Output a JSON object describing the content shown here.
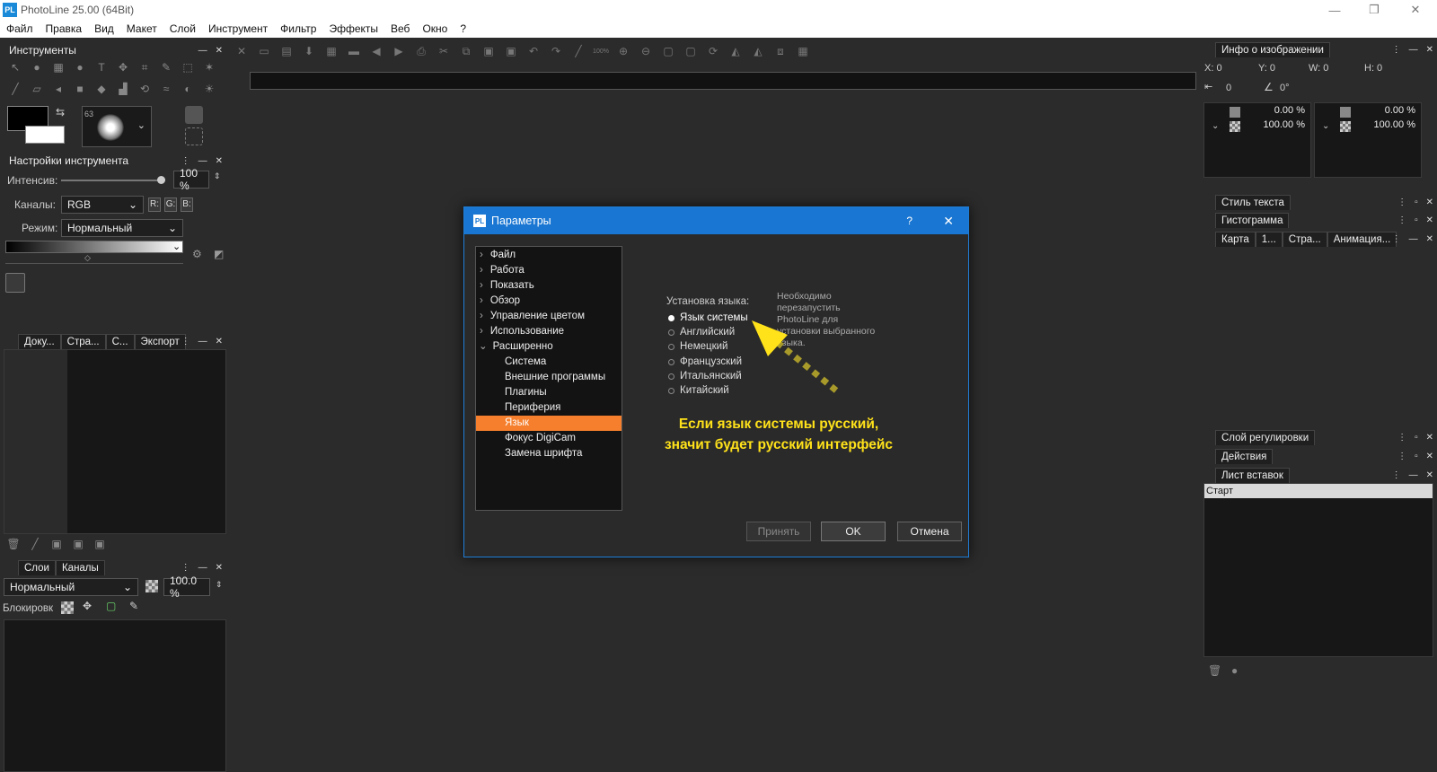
{
  "app": {
    "title": "PhotoLine 25.00 (64Bit)",
    "logo": "PL"
  },
  "window_controls": {
    "minimize": "—",
    "maximize": "❐",
    "close": "✕"
  },
  "menu": [
    "Файл",
    "Правка",
    "Вид",
    "Макет",
    "Слой",
    "Инструмент",
    "Фильтр",
    "Эффекты",
    "Веб",
    "Окно",
    "?"
  ],
  "left": {
    "tools_title": "Инструменты",
    "brush_size": "63",
    "tool_settings_title": "Настройки инструмента",
    "intensity_label": "Интенсив:",
    "intensity_value": "100 %",
    "channels_label": "Каналы:",
    "channels_value": "RGB",
    "channel_buttons": [
      "R:",
      "G:",
      "B:"
    ],
    "mode_label": "Режим:",
    "mode_value": "Нормальный",
    "doc_tabs": [
      "Доку...",
      "Стра...",
      "С...",
      "Экспорт"
    ],
    "layers_tabs": [
      "Слои",
      "Каналы"
    ],
    "layer_mode": "Нормальный",
    "layer_opacity": "100.0 %",
    "lock_label": "Блокировк"
  },
  "right": {
    "info_title": "Инфо о изображении",
    "x": "X: 0",
    "y": "Y: 0",
    "w": "W: 0",
    "h": "H: 0",
    "dist": "0",
    "angle": "0°",
    "pct1": "0.00 %",
    "pct2": "100.00 %",
    "pct3": "0.00 %",
    "pct4": "100.00 %",
    "text_style": "Стиль текста",
    "histogram": "Гистограмма",
    "tabs3": [
      "Карта",
      "1...",
      "Стра...",
      "Анимация..."
    ],
    "adj_layer": "Слой регулировки",
    "actions": "Действия",
    "clipboard": "Лист вставок",
    "clip_item": "Старт"
  },
  "toolbar": {
    "zoom": "100%"
  },
  "dialog": {
    "title": "Параметры",
    "help": "?",
    "close": "✕",
    "tree": [
      {
        "label": "Файл",
        "level": 0
      },
      {
        "label": "Работа",
        "level": 0
      },
      {
        "label": "Показать",
        "level": 0
      },
      {
        "label": "Обзор",
        "level": 0
      },
      {
        "label": "Управление цветом",
        "level": 0
      },
      {
        "label": "Использование",
        "level": 0
      },
      {
        "label": "Расширенно",
        "level": 0,
        "open": true
      },
      {
        "label": "Система",
        "level": 1
      },
      {
        "label": "Внешние программы",
        "level": 1
      },
      {
        "label": "Плагины",
        "level": 1
      },
      {
        "label": "Периферия",
        "level": 1
      },
      {
        "label": "Язык",
        "level": 1,
        "selected": true
      },
      {
        "label": "Фокус DigiCam",
        "level": 1
      },
      {
        "label": "Замена шрифта",
        "level": 1
      }
    ],
    "lang_label": "Установка языка:",
    "lang_options": [
      {
        "label": "Язык системы",
        "checked": true
      },
      {
        "label": "Английский"
      },
      {
        "label": "Немецкий"
      },
      {
        "label": "Французский"
      },
      {
        "label": "Итальянский"
      },
      {
        "label": "Китайский"
      }
    ],
    "note": "Необходимо перезапустить PhotoLine для установки выбранного языка.",
    "annotation_line1": "Если язык системы русский,",
    "annotation_line2": "значит будет русский интерфейс",
    "apply": "Принять",
    "ok": "OK",
    "cancel": "Отмена"
  },
  "colors": {
    "accent": "#1976d2",
    "selection": "#f57f2c",
    "annotation": "#ffe21a"
  }
}
